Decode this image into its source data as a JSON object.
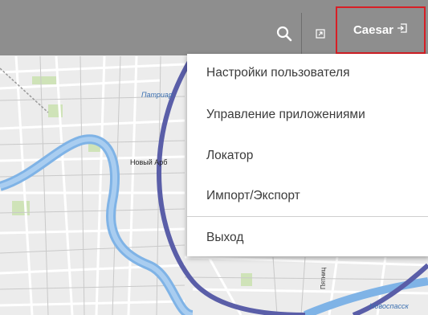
{
  "topbar": {
    "user_name": "Caesar",
    "search_icon": "search-icon",
    "expand_icon": "expand-icon",
    "logout_icon": "logout-icon"
  },
  "menu": {
    "items": [
      {
        "label": "Настройки пользователя"
      },
      {
        "label": "Управление приложениями"
      },
      {
        "label": "Локатор"
      },
      {
        "label": "Импорт/Экспорт"
      },
      {
        "label": "Выход"
      }
    ]
  },
  "map": {
    "labels": {
      "patriar": "Патриар",
      "arbat": "Новый Арб",
      "novosp": "Новоспасск",
      "pyatnits": "Пятниц"
    }
  },
  "colors": {
    "topbar": "#8e8e8e",
    "highlight_border": "#d81f26",
    "river": "#7fb3e6",
    "ring_road": "#5a5ea8"
  }
}
